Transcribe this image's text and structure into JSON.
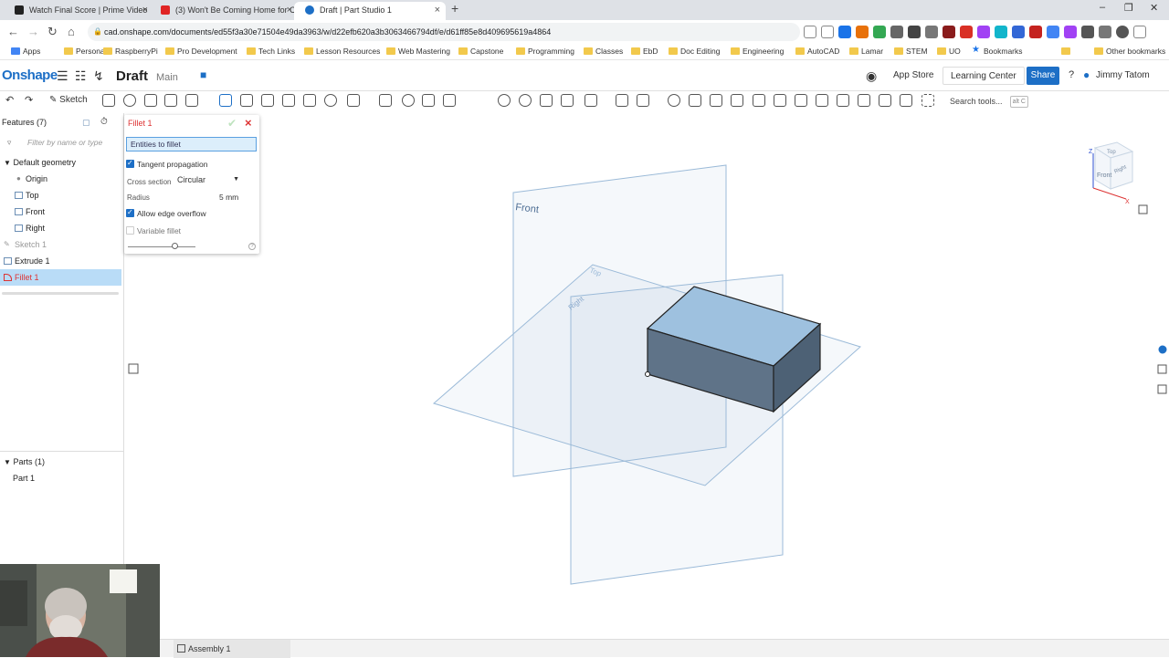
{
  "browser": {
    "tabs": [
      {
        "title": "Watch Final Score | Prime Video",
        "active": false,
        "icon_color": "#222222"
      },
      {
        "title": "(3) Won't Be Coming Home for C",
        "active": false,
        "icon_color": "#e02424"
      },
      {
        "title": "Draft | Part Studio 1",
        "active": true,
        "icon_color": "#1d6fc6"
      }
    ],
    "new_tab": "+",
    "close_glyph": "×",
    "url": "cad.onshape.com/documents/ed55f3a30e71504e49da3963/w/d22efb620a3b3063466794df/e/d61ff85e8d409695619a4864",
    "bookmarks": [
      "Apps",
      "Personal",
      "RaspberryPi",
      "Pro Development",
      "Tech Links",
      "Lesson Resources",
      "Web Mastering",
      "Capstone",
      "Programming",
      "Classes",
      "EbD",
      "Doc Editing",
      "Engineering",
      "AutoCAD",
      "Lamar",
      "STEM",
      "UO",
      "Bookmarks"
    ],
    "other_bookmarks": "Other bookmarks",
    "more_glyph": "»"
  },
  "header": {
    "logo": "Onshape",
    "doc_title": "Draft",
    "workspace": "Main",
    "app_store": "App Store",
    "learning_center": "Learning Center",
    "share": "Share",
    "help": "?",
    "user": "Jimmy Tatom"
  },
  "toolbar": {
    "sketch": "Sketch",
    "search_placeholder": "Search tools...",
    "shortcut": "alt C"
  },
  "features": {
    "title": "Features (7)",
    "filter_placeholder": "Filter by name or type",
    "default_geometry": "Default geometry",
    "items": [
      "Origin",
      "Top",
      "Front",
      "Right",
      "Sketch 1",
      "Extrude 1",
      "Fillet 1"
    ],
    "parts_header": "Parts (1)",
    "parts": [
      "Part 1"
    ]
  },
  "fillet": {
    "title": "Fillet 1",
    "entities": "Entities to fillet",
    "tangent": "Tangent propagation",
    "cross_section_label": "Cross section",
    "cross_section_value": "Circular",
    "radius_label": "Radius",
    "radius_value": "5 mm",
    "overflow": "Allow edge overflow",
    "variable": "Variable fillet"
  },
  "viewport": {
    "plane_front": "Front",
    "plane_top": "Top",
    "plane_right": "Right",
    "cube_top": "Top",
    "cube_front": "Front",
    "cube_right": "Right",
    "axis_z": "Z",
    "axis_x": "X",
    "plane_color": "#9bbad8",
    "box_top_color": "#9ec1df",
    "box_front_color": "#5f7388",
    "box_side_color": "#4d6175"
  },
  "bottom": {
    "assembly_tab": "Assembly 1"
  }
}
